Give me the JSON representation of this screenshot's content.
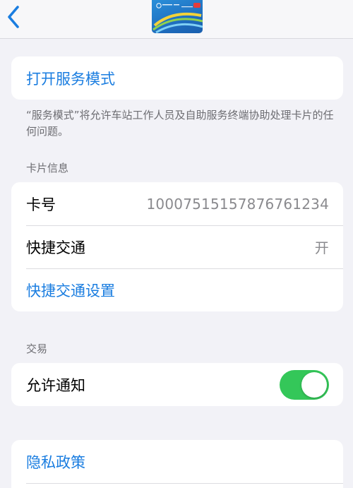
{
  "service_mode": {
    "open_label": "打开服务模式",
    "footnote": "“服务模式”将允许车站工作人员及自助服务终端协助处理卡片的任何问题。"
  },
  "card_info": {
    "header": "卡片信息",
    "card_number_label": "卡号",
    "card_number_value": "10007515157876761234",
    "express_transit_label": "快捷交通",
    "express_transit_value": "开",
    "express_transit_settings_label": "快捷交通设置"
  },
  "transactions": {
    "header": "交易",
    "allow_notifications_label": "允许通知",
    "allow_notifications_on": true
  },
  "privacy": {
    "policy_label": "隐私政策"
  },
  "colors": {
    "accent": "#1a7de0",
    "toggle_on": "#34c759",
    "background": "#f2f2f7"
  },
  "icons": {
    "back": "chevron-left-icon",
    "card": "transit-card-thumbnail"
  }
}
